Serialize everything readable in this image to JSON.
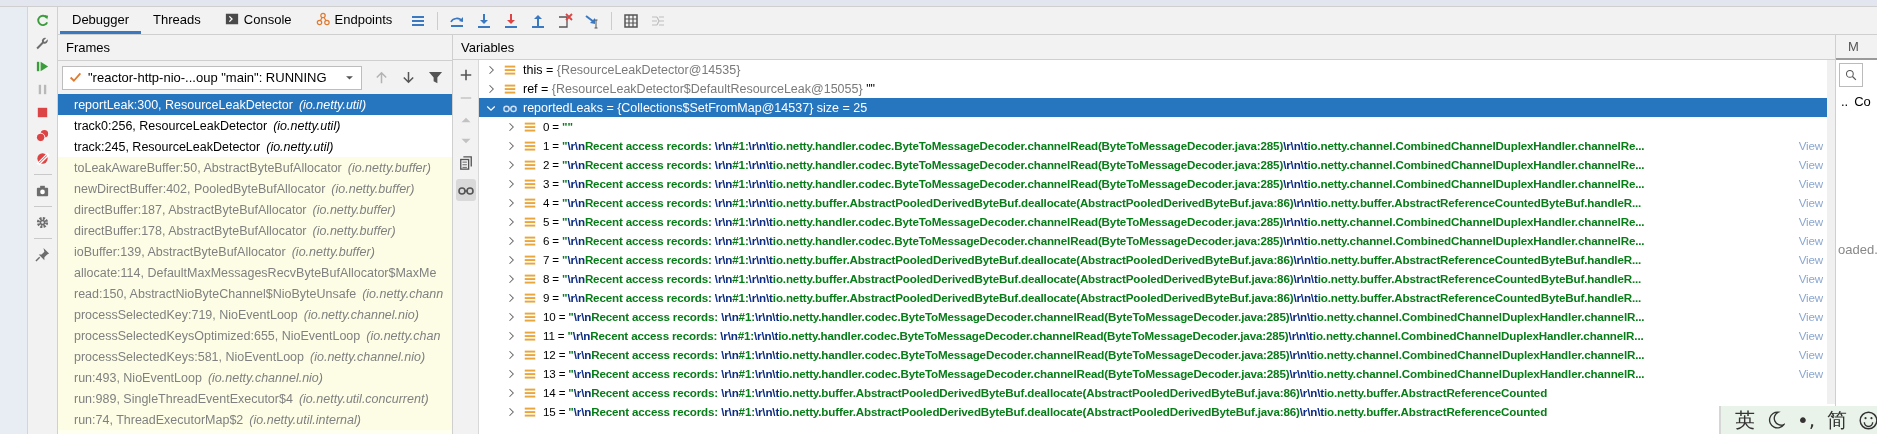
{
  "toolbar": {
    "tabs": [
      {
        "label": "Debugger",
        "selected": true,
        "kind": "plain"
      },
      {
        "label": "Threads",
        "selected": false,
        "kind": "plain"
      },
      {
        "label": "Console",
        "selected": false,
        "kind": "console"
      },
      {
        "label": "Endpoints",
        "selected": false,
        "kind": "endpoints"
      }
    ]
  },
  "frames_panel": {
    "title": "Frames",
    "thread": "\"reactor-http-nio-...oup \"main\": RUNNING",
    "frames": [
      {
        "method": "reportLeak:300, ResourceLeakDetector",
        "package": "(io.netty.util)",
        "selected": true,
        "kind": "user"
      },
      {
        "method": "track0:256, ResourceLeakDetector",
        "package": "(io.netty.util)",
        "selected": false,
        "kind": "user"
      },
      {
        "method": "track:245, ResourceLeakDetector",
        "package": "(io.netty.util)",
        "selected": false,
        "kind": "user"
      },
      {
        "method": "toLeakAwareBuffer:50, AbstractByteBufAllocator",
        "package": "(io.netty.buffer)",
        "selected": false,
        "kind": "library"
      },
      {
        "method": "newDirectBuffer:402, PooledByteBufAllocator",
        "package": "(io.netty.buffer)",
        "selected": false,
        "kind": "library"
      },
      {
        "method": "directBuffer:187, AbstractByteBufAllocator",
        "package": "(io.netty.buffer)",
        "selected": false,
        "kind": "library"
      },
      {
        "method": "directBuffer:178, AbstractByteBufAllocator",
        "package": "(io.netty.buffer)",
        "selected": false,
        "kind": "library"
      },
      {
        "method": "ioBuffer:139, AbstractByteBufAllocator",
        "package": "(io.netty.buffer)",
        "selected": false,
        "kind": "library"
      },
      {
        "method": "allocate:114, DefaultMaxMessagesRecvByteBufAllocator$MaxMe",
        "selected": false,
        "kind": "library"
      },
      {
        "method": "read:150, AbstractNioByteChannel$NioByteUnsafe",
        "package": "(io.netty.chann",
        "selected": false,
        "kind": "library"
      },
      {
        "method": "processSelectedKey:719, NioEventLoop",
        "package": "(io.netty.channel.nio)",
        "selected": false,
        "kind": "library"
      },
      {
        "method": "processSelectedKeysOptimized:655, NioEventLoop",
        "package": "(io.netty.chan",
        "selected": false,
        "kind": "library"
      },
      {
        "method": "processSelectedKeys:581, NioEventLoop",
        "package": "(io.netty.channel.nio)",
        "selected": false,
        "kind": "library"
      },
      {
        "method": "run:493, NioEventLoop",
        "package": "(io.netty.channel.nio)",
        "selected": false,
        "kind": "library"
      },
      {
        "method": "run:989, SingleThreadEventExecutor$4",
        "package": "(io.netty.util.concurrent)",
        "selected": false,
        "kind": "library"
      },
      {
        "method": "run:74, ThreadExecutorMap$2",
        "package": "(io.netty.util.internal)",
        "selected": false,
        "kind": "library"
      }
    ]
  },
  "variables_panel": {
    "title": "Variables",
    "variables": [
      {
        "name": "this =",
        "value": "{ResourceLeakDetector@14535}",
        "selected": false,
        "expanded": false,
        "kind": "field"
      },
      {
        "name": "ref =",
        "value": "{ResourceLeakDetector$DefaultResourceLeak@15055}",
        "suffix": "\"\"",
        "selected": false,
        "expanded": false,
        "kind": "field"
      },
      {
        "name": "reportedLeaks =",
        "value": "{Collections$SetFromMap@14537}",
        "suffix": "size = 25",
        "selected": true,
        "expanded": true,
        "kind": "watch",
        "children": [
          {
            "name": "0 =",
            "value": "\"\""
          },
          {
            "name": "1 =",
            "value": "\"\\r\\nRecent access records: \\r\\n#1:\\r\\n\\tio.netty.handler.codec.ByteToMessageDecoder.channelRead(ByteToMessageDecoder.java:285)\\r\\n\\tio.netty.channel.CombinedChannelDuplexHandler.channelRe...",
            "link": "View"
          },
          {
            "name": "2 =",
            "value": "\"\\r\\nRecent access records: \\r\\n#1:\\r\\n\\tio.netty.handler.codec.ByteToMessageDecoder.channelRead(ByteToMessageDecoder.java:285)\\r\\n\\tio.netty.channel.CombinedChannelDuplexHandler.channelRe...",
            "link": "View"
          },
          {
            "name": "3 =",
            "value": "\"\\r\\nRecent access records: \\r\\n#1:\\r\\n\\tio.netty.handler.codec.ByteToMessageDecoder.channelRead(ByteToMessageDecoder.java:285)\\r\\n\\tio.netty.channel.CombinedChannelDuplexHandler.channelRe...",
            "link": "View"
          },
          {
            "name": "4 =",
            "value": "\"\\r\\nRecent access records: \\r\\n#1:\\r\\n\\tio.netty.buffer.AbstractPooledDerivedByteBuf.deallocate(AbstractPooledDerivedByteBuf.java:86)\\r\\n\\tio.netty.buffer.AbstractReferenceCountedByteBuf.handleR...",
            "link": "View"
          },
          {
            "name": "5 =",
            "value": "\"\\r\\nRecent access records: \\r\\n#1:\\r\\n\\tio.netty.handler.codec.ByteToMessageDecoder.channelRead(ByteToMessageDecoder.java:285)\\r\\n\\tio.netty.channel.CombinedChannelDuplexHandler.channelRe...",
            "link": "View"
          },
          {
            "name": "6 =",
            "value": "\"\\r\\nRecent access records: \\r\\n#1:\\r\\n\\tio.netty.handler.codec.ByteToMessageDecoder.channelRead(ByteToMessageDecoder.java:285)\\r\\n\\tio.netty.channel.CombinedChannelDuplexHandler.channelRe...",
            "link": "View"
          },
          {
            "name": "7 =",
            "value": "\"\\r\\nRecent access records: \\r\\n#1:\\r\\n\\tio.netty.buffer.AbstractPooledDerivedByteBuf.deallocate(AbstractPooledDerivedByteBuf.java:86)\\r\\n\\tio.netty.buffer.AbstractReferenceCountedByteBuf.handleR...",
            "link": "View"
          },
          {
            "name": "8 =",
            "value": "\"\\r\\nRecent access records: \\r\\n#1:\\r\\n\\tio.netty.buffer.AbstractPooledDerivedByteBuf.deallocate(AbstractPooledDerivedByteBuf.java:86)\\r\\n\\tio.netty.buffer.AbstractReferenceCountedByteBuf.handleR...",
            "link": "View"
          },
          {
            "name": "9 =",
            "value": "\"\\r\\nRecent access records: \\r\\n#1:\\r\\n\\tio.netty.buffer.AbstractPooledDerivedByteBuf.deallocate(AbstractPooledDerivedByteBuf.java:86)\\r\\n\\tio.netty.buffer.AbstractReferenceCountedByteBuf.handleR...",
            "link": "View"
          },
          {
            "name": "10 =",
            "value": "\"\\r\\nRecent access records: \\r\\n#1:\\r\\n\\tio.netty.handler.codec.ByteToMessageDecoder.channelRead(ByteToMessageDecoder.java:285)\\r\\n\\tio.netty.channel.CombinedChannelDuplexHandler.channelR...",
            "link": "View"
          },
          {
            "name": "11 =",
            "value": "\"\\r\\nRecent access records: \\r\\n#1:\\r\\n\\tio.netty.handler.codec.ByteToMessageDecoder.channelRead(ByteToMessageDecoder.java:285)\\r\\n\\tio.netty.channel.CombinedChannelDuplexHandler.channelR...",
            "link": "View"
          },
          {
            "name": "12 =",
            "value": "\"\\r\\nRecent access records: \\r\\n#1:\\r\\n\\tio.netty.handler.codec.ByteToMessageDecoder.channelRead(ByteToMessageDecoder.java:285)\\r\\n\\tio.netty.channel.CombinedChannelDuplexHandler.channelR...",
            "link": "View"
          },
          {
            "name": "13 =",
            "value": "\"\\r\\nRecent access records: \\r\\n#1:\\r\\n\\tio.netty.handler.codec.ByteToMessageDecoder.channelRead(ByteToMessageDecoder.java:285)\\r\\n\\tio.netty.channel.CombinedChannelDuplexHandler.channelR...",
            "link": "View"
          },
          {
            "name": "14 =",
            "value": "\"\\r\\nRecent access records: \\r\\n#1:\\r\\n\\tio.netty.buffer.AbstractPooledDerivedByteBuf.deallocate(AbstractPooledDerivedByteBuf.java:86)\\r\\n\\tio.netty.buffer.AbstractReferenceCounted"
          },
          {
            "name": "15 =",
            "value": "\"\\r\\nRecent access records: \\r\\n#1:\\r\\n\\tio.netty.buffer.AbstractPooledDerivedByteBuf.deallocate(AbstractPooledDerivedByteBuf.java:86)\\r\\n\\tio.netty.buffer.AbstractReferenceCounted"
          }
        ]
      }
    ]
  },
  "side_panel": {
    "tab": "M",
    "path": "..",
    "item": "Co",
    "message": "oaded."
  },
  "ime_bar": {
    "items": [
      {
        "label": "英",
        "kind": "text"
      },
      {
        "kind": "moon"
      },
      {
        "label": "•,",
        "kind": "text"
      },
      {
        "label": "简",
        "kind": "text"
      },
      {
        "kind": "smiley"
      }
    ]
  }
}
